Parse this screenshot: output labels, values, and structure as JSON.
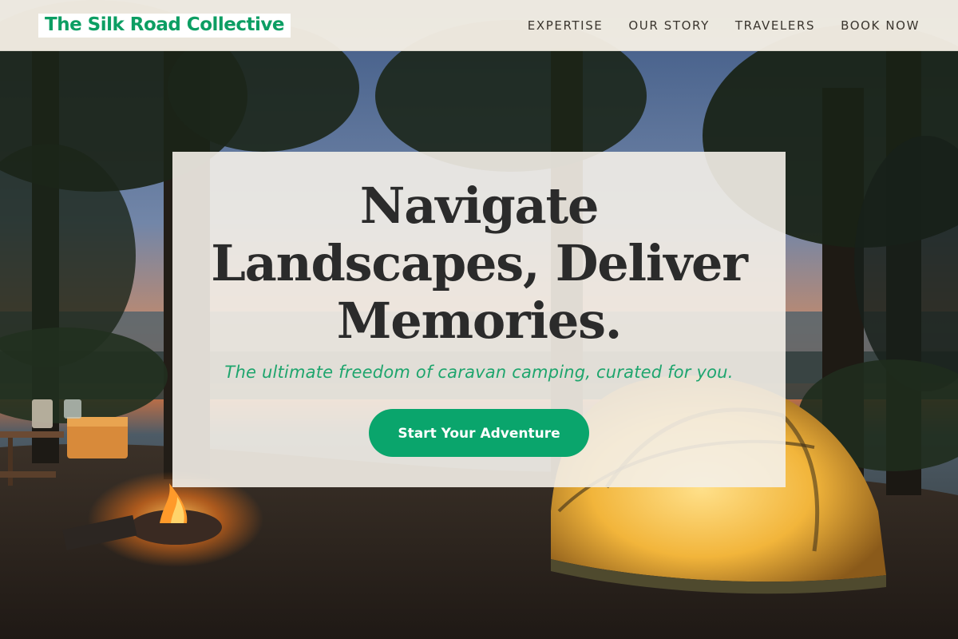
{
  "header": {
    "logo_text": "The Silk Road Collective",
    "nav": [
      {
        "label": "EXPERTISE"
      },
      {
        "label": "OUR STORY"
      },
      {
        "label": "TRAVELERS"
      },
      {
        "label": "BOOK NOW"
      }
    ]
  },
  "hero": {
    "title": "Navigate Landscapes, Deliver Memories.",
    "subtitle": "The ultimate freedom of caravan camping, curated for you.",
    "cta_label": "Start Your Adventure",
    "background_image": "campsite-at-dusk-photo"
  },
  "colors": {
    "brand_green": "#0aa56c",
    "subtitle_green": "#1ea56d",
    "header_bg": "#f4eee4",
    "card_bg": "#f4f0e8",
    "title_text": "#2b2b2b"
  }
}
